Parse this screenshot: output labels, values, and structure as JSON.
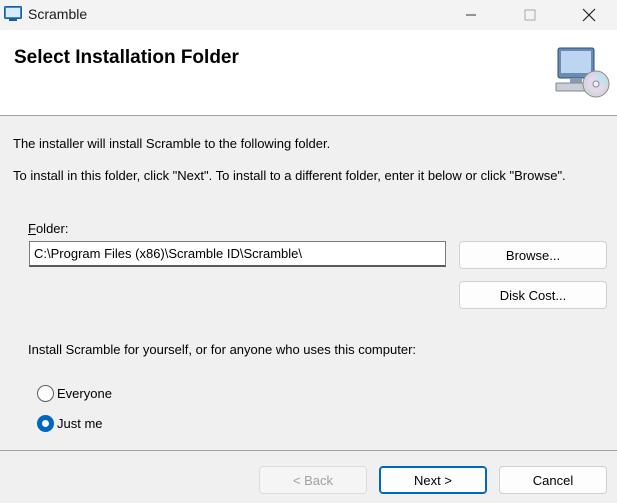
{
  "window": {
    "title": "Scramble",
    "app_icon": "installer-icon",
    "minimize_icon": "minimize-icon",
    "maximize_icon": "maximize-icon",
    "close_icon": "close-icon"
  },
  "header": {
    "title": "Select Installation Folder",
    "icon": "computer-cd-icon"
  },
  "body": {
    "intro_line1": "The installer will install Scramble to the following folder.",
    "intro_line2": "To install in this folder, click \"Next\". To install to a different folder, enter it below or click \"Browse\"."
  },
  "folder": {
    "label_mnemonic": "F",
    "label_rest": "older:",
    "value": "C:\\Program Files (x86)\\Scramble ID\\Scramble\\"
  },
  "buttons": {
    "browse": "Browse...",
    "disk_cost": "Disk Cost...",
    "back": "< Back",
    "next": "Next >",
    "cancel": "Cancel"
  },
  "install_for": {
    "prompt": "Install Scramble for yourself, or for anyone who uses this computer:",
    "options": [
      {
        "label": "Everyone",
        "checked": false
      },
      {
        "label": "Just me",
        "checked": true
      }
    ]
  },
  "colors": {
    "accent": "#0067c0",
    "window_bg": "#f0f0f0",
    "header_bg": "#ffffff"
  }
}
